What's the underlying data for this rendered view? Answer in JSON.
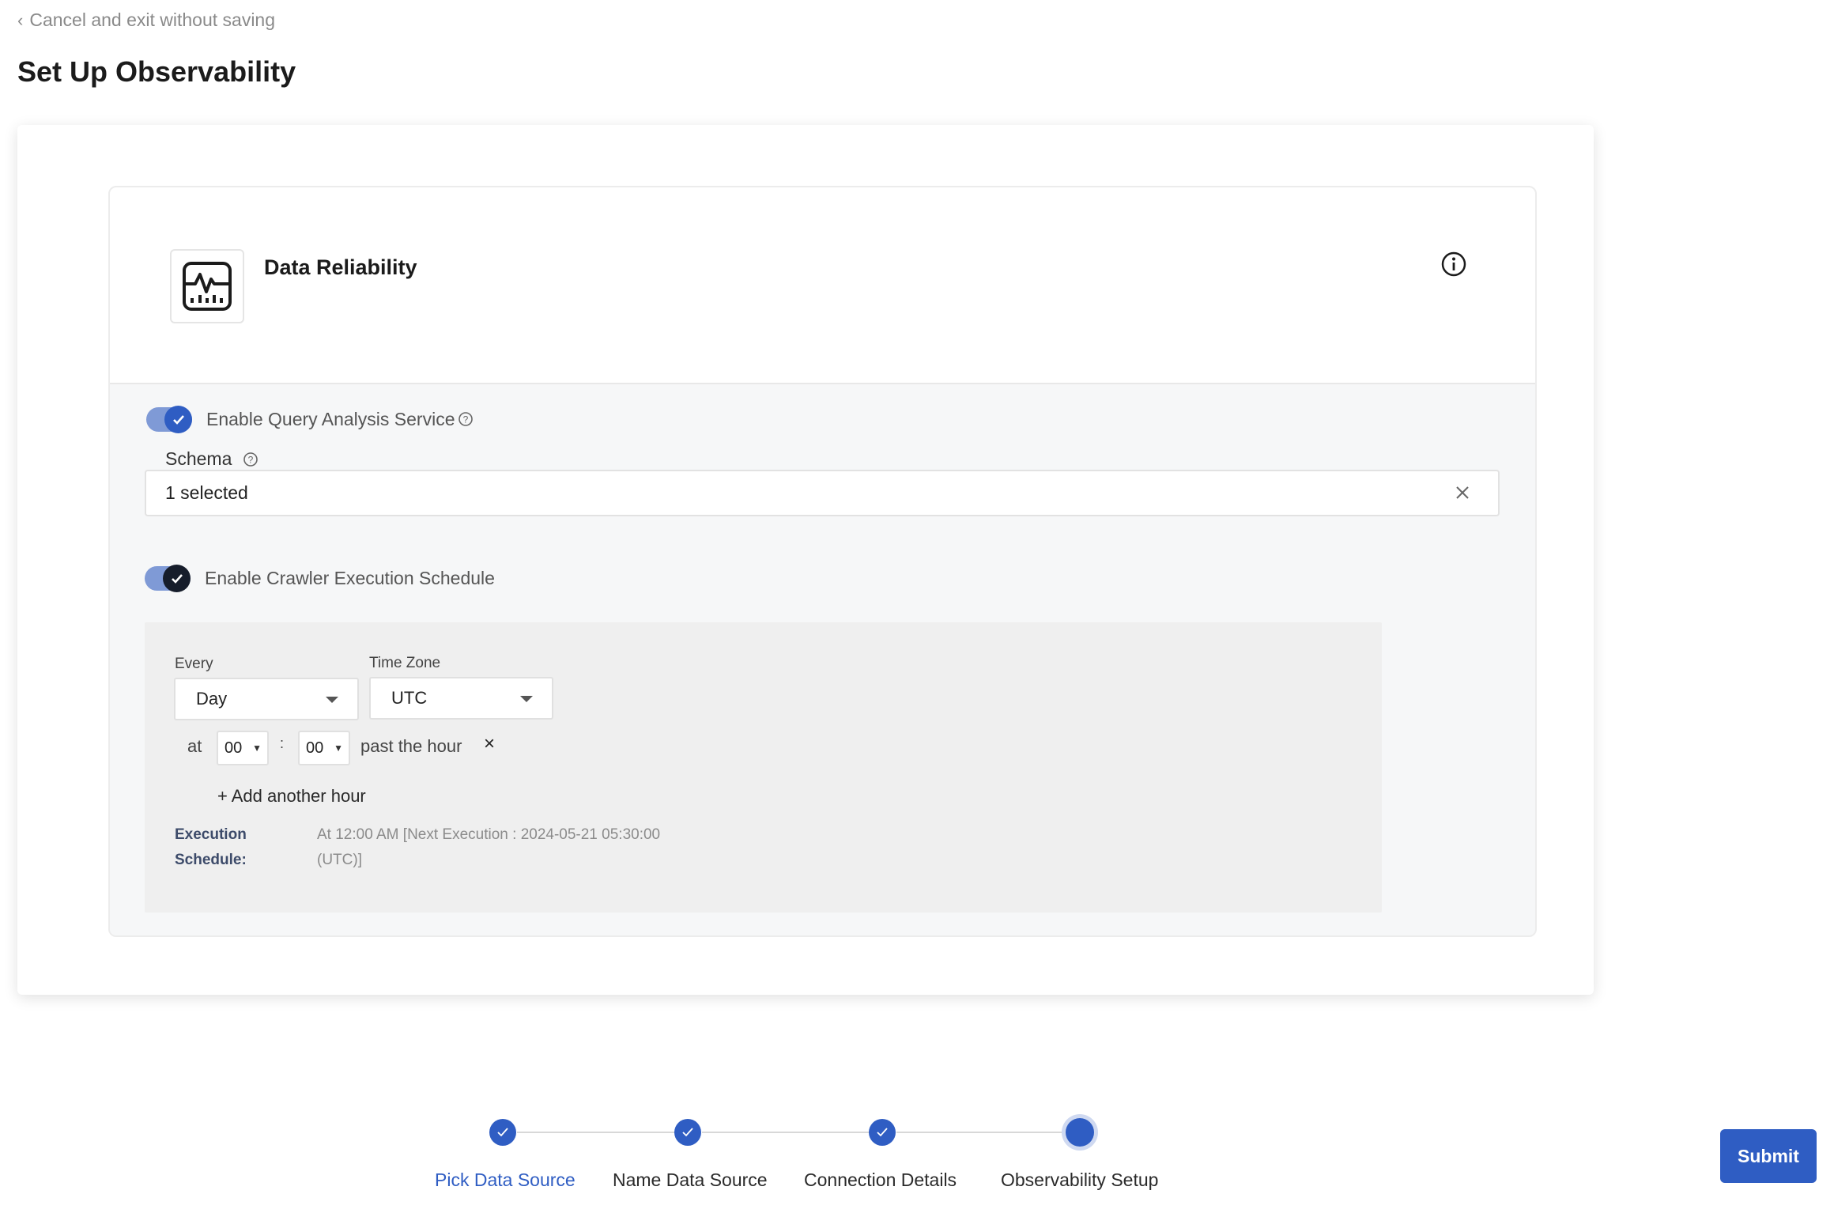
{
  "nav": {
    "back_label": "Cancel and exit without saving"
  },
  "page": {
    "title": "Set Up Observability"
  },
  "panel": {
    "title": "Data Reliability",
    "query_analysis": {
      "label": "Enable Query Analysis Service",
      "enabled": true
    },
    "schema": {
      "label": "Schema",
      "value": "1 selected"
    },
    "crawler": {
      "label": "Enable Crawler Execution Schedule",
      "enabled": true
    },
    "schedule": {
      "every_label": "Every",
      "every_value": "Day",
      "timezone_label": "Time Zone",
      "timezone_value": "UTC",
      "at_label": "at",
      "hour_value": "00",
      "separator": ":",
      "minute_value": "00",
      "past_label": "past the hour",
      "remove_glyph": "×",
      "add_hour_label": "+ Add another hour",
      "exec_key_line1": "Execution",
      "exec_key_line2": "Schedule:",
      "exec_val_line1": "At 12:00 AM [Next Execution : 2024-05-21 05:30:00",
      "exec_val_line2": "(UTC)]"
    }
  },
  "stepper": {
    "steps": [
      {
        "label": "Pick Data Source",
        "state": "done"
      },
      {
        "label": "Name Data Source",
        "state": "done"
      },
      {
        "label": "Connection Details",
        "state": "done"
      },
      {
        "label": "Observability Setup",
        "state": "current"
      }
    ]
  },
  "actions": {
    "submit_label": "Submit"
  },
  "colors": {
    "primary": "#2f5dc3",
    "toggle_track": "#7f9ad6",
    "muted_text": "#8a8a8a"
  }
}
